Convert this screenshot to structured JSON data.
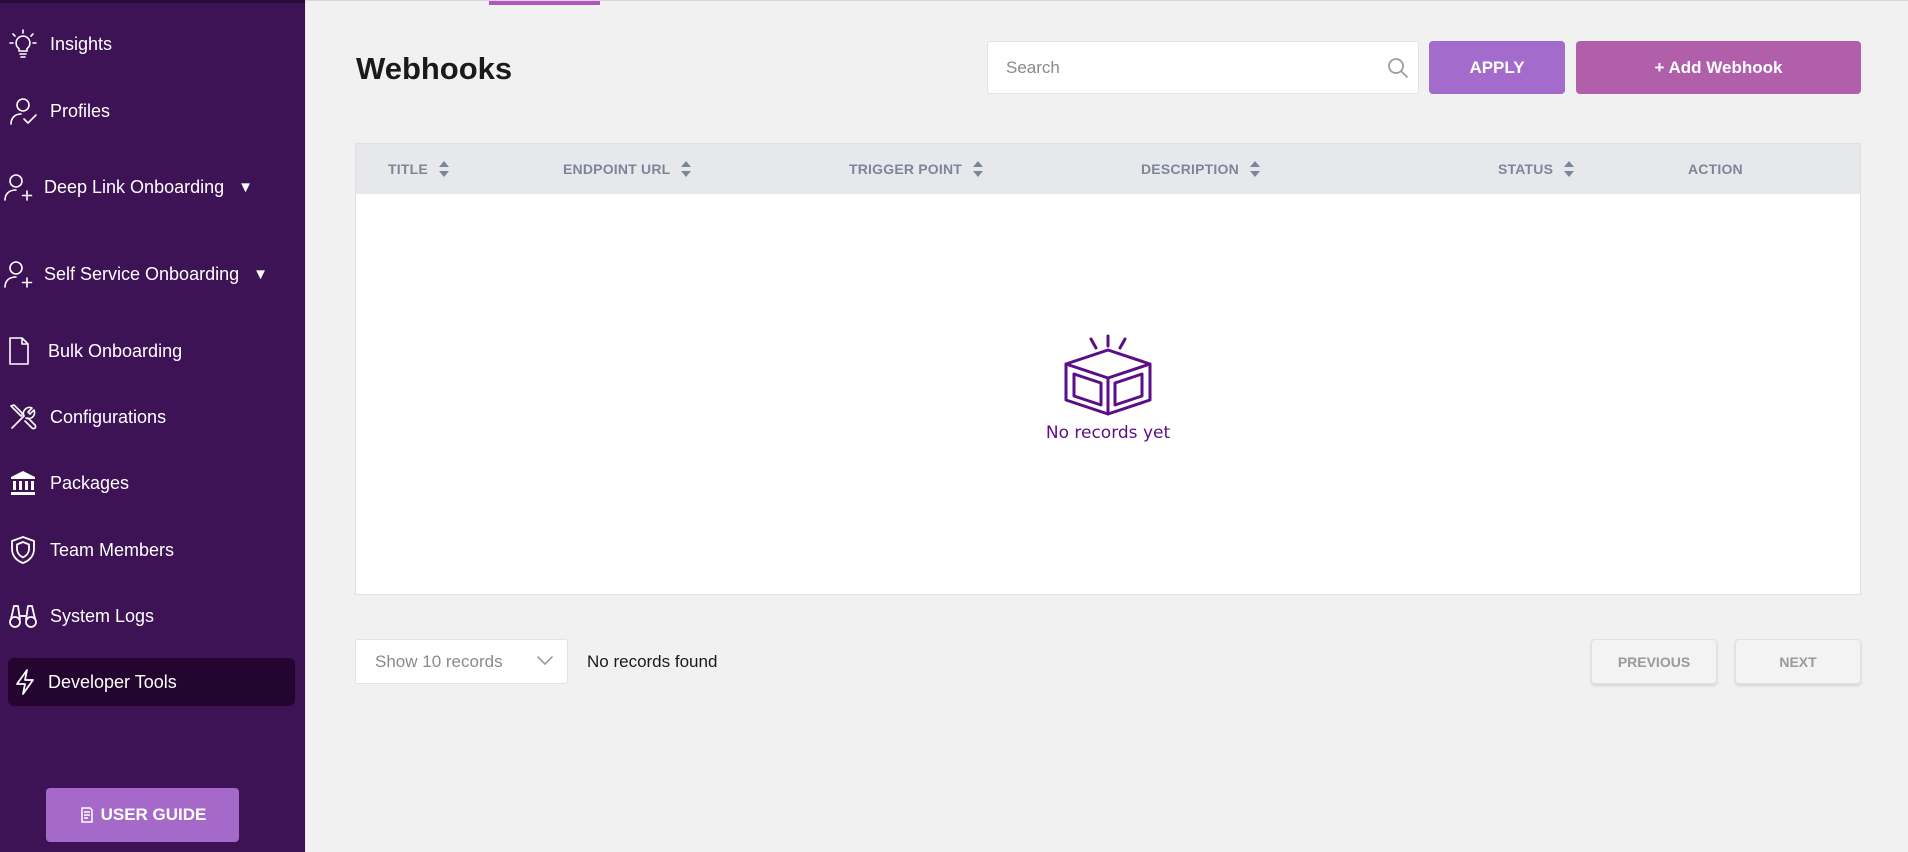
{
  "sidebar": {
    "items": [
      {
        "label": "Insights",
        "icon": "lightbulb-icon"
      },
      {
        "label": "Profiles",
        "icon": "user-check-icon"
      },
      {
        "label": "Deep Link Onboarding",
        "icon": "user-plus-icon",
        "caret": "▼"
      },
      {
        "label": "Self Service Onboarding",
        "icon": "user-plus-icon",
        "caret": "▼"
      },
      {
        "label": "Bulk Onboarding",
        "icon": "document-icon"
      },
      {
        "label": "Configurations",
        "icon": "tools-icon"
      },
      {
        "label": "Packages",
        "icon": "bank-icon"
      },
      {
        "label": "Team Members",
        "icon": "shield-icon"
      },
      {
        "label": "System Logs",
        "icon": "binoculars-icon"
      },
      {
        "label": "Developer Tools",
        "icon": "lightning-icon",
        "active": true
      }
    ],
    "user_guide_label": "USER GUIDE"
  },
  "header": {
    "title": "Webhooks",
    "search_placeholder": "Search",
    "apply_label": "APPLY",
    "add_label": "+ Add Webhook"
  },
  "table": {
    "columns": [
      "TITLE",
      "ENDPOINT URL",
      "TRIGGER POINT",
      "DESCRIPTION",
      "STATUS",
      "ACTION"
    ],
    "empty_text": "No records yet"
  },
  "footer": {
    "records_select": "Show 10 records",
    "status_text": "No records found",
    "previous_label": "PREVIOUS",
    "next_label": "NEXT"
  },
  "colors": {
    "sidebar_bg": "#3e1355",
    "active_bg": "#23052f",
    "apply_bg": "#a26bcc",
    "add_bg": "#b15eab",
    "empty_accent": "#5b0e86"
  }
}
